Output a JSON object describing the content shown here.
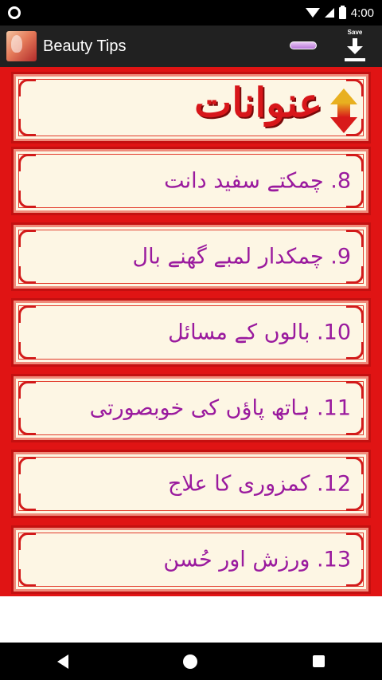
{
  "status_bar": {
    "time": "4:00"
  },
  "app_bar": {
    "title": "Beauty Tips",
    "save_label": "Save"
  },
  "header": {
    "title": "عنوانات"
  },
  "items": [
    {
      "label": "8. چمکتے سفید دانت"
    },
    {
      "label": "9. چمکدار لمبے گھنے بال"
    },
    {
      "label": "10. بالوں کے مسائل"
    },
    {
      "label": "11. ہاتھ پاؤں کی خوبصورتی"
    },
    {
      "label": "12. کمزوری کا علاج"
    },
    {
      "label": "13. ورزش اور حُسن"
    }
  ],
  "colors": {
    "page_red": "#e01414",
    "card_cream": "#fdf6e4",
    "item_text": "#9a1a9e",
    "header_text": "#d8161a"
  },
  "icons": [
    "app-logo-icon",
    "save-download-icon",
    "up-down-arrow-icon",
    "wifi-icon",
    "signal-icon",
    "battery-icon",
    "nav-back-icon",
    "nav-home-icon",
    "nav-recents-icon"
  ]
}
